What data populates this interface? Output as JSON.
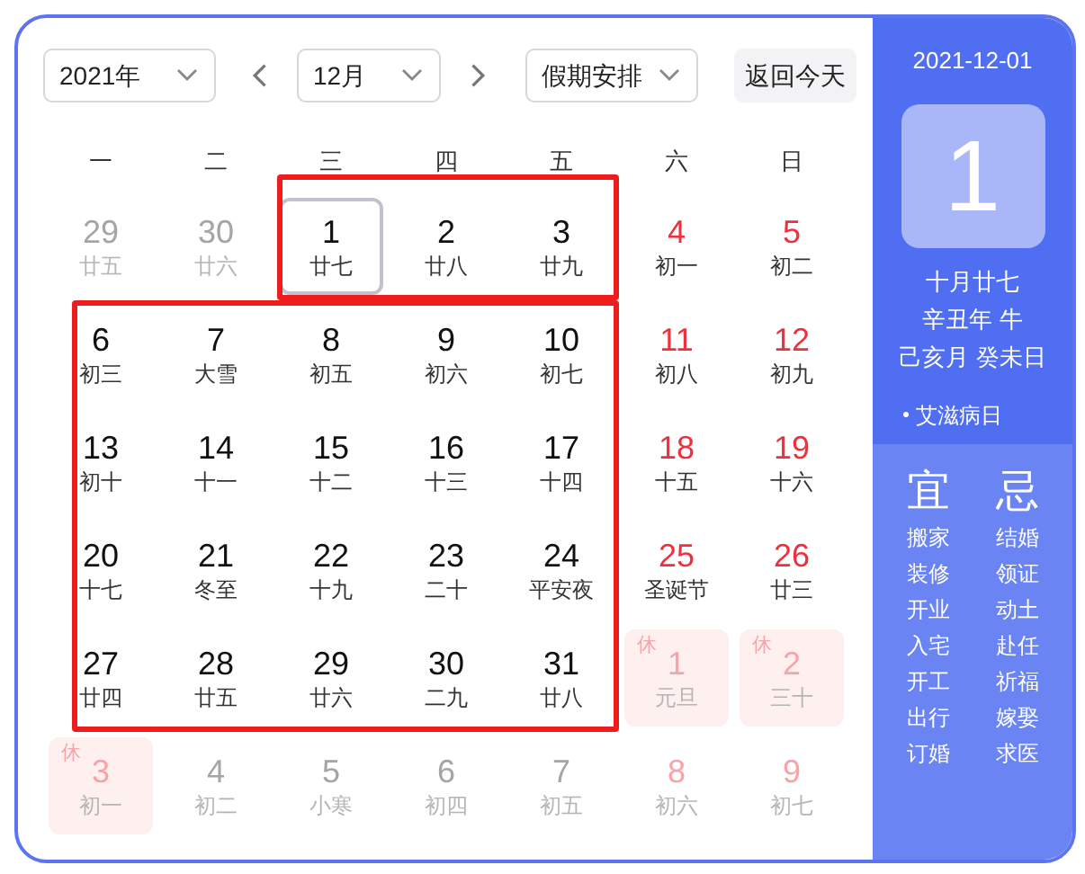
{
  "toolbar": {
    "year_select": "2021年",
    "month_select": "12月",
    "holiday_select": "假期安排",
    "today_button": "返回今天"
  },
  "weekdays": [
    "一",
    "二",
    "三",
    "四",
    "五",
    "六",
    "日"
  ],
  "weeks": [
    [
      {
        "date": "29",
        "lunar": "廿五",
        "muted": true,
        "weekend": false,
        "selected": false
      },
      {
        "date": "30",
        "lunar": "廿六",
        "muted": true,
        "weekend": false,
        "selected": false
      },
      {
        "date": "1",
        "lunar": "廿七",
        "muted": false,
        "weekend": false,
        "selected": true
      },
      {
        "date": "2",
        "lunar": "廿八",
        "muted": false,
        "weekend": false,
        "selected": false
      },
      {
        "date": "3",
        "lunar": "廿九",
        "muted": false,
        "weekend": false,
        "selected": false
      },
      {
        "date": "4",
        "lunar": "初一",
        "muted": false,
        "weekend": true,
        "selected": false
      },
      {
        "date": "5",
        "lunar": "初二",
        "muted": false,
        "weekend": true,
        "selected": false
      }
    ],
    [
      {
        "date": "6",
        "lunar": "初三",
        "muted": false,
        "weekend": false,
        "selected": false
      },
      {
        "date": "7",
        "lunar": "大雪",
        "muted": false,
        "weekend": false,
        "selected": false
      },
      {
        "date": "8",
        "lunar": "初五",
        "muted": false,
        "weekend": false,
        "selected": false
      },
      {
        "date": "9",
        "lunar": "初六",
        "muted": false,
        "weekend": false,
        "selected": false
      },
      {
        "date": "10",
        "lunar": "初七",
        "muted": false,
        "weekend": false,
        "selected": false
      },
      {
        "date": "11",
        "lunar": "初八",
        "muted": false,
        "weekend": true,
        "selected": false
      },
      {
        "date": "12",
        "lunar": "初九",
        "muted": false,
        "weekend": true,
        "selected": false
      }
    ],
    [
      {
        "date": "13",
        "lunar": "初十",
        "muted": false,
        "weekend": false,
        "selected": false
      },
      {
        "date": "14",
        "lunar": "十一",
        "muted": false,
        "weekend": false,
        "selected": false
      },
      {
        "date": "15",
        "lunar": "十二",
        "muted": false,
        "weekend": false,
        "selected": false
      },
      {
        "date": "16",
        "lunar": "十三",
        "muted": false,
        "weekend": false,
        "selected": false
      },
      {
        "date": "17",
        "lunar": "十四",
        "muted": false,
        "weekend": false,
        "selected": false
      },
      {
        "date": "18",
        "lunar": "十五",
        "muted": false,
        "weekend": true,
        "selected": false
      },
      {
        "date": "19",
        "lunar": "十六",
        "muted": false,
        "weekend": true,
        "selected": false
      }
    ],
    [
      {
        "date": "20",
        "lunar": "十七",
        "muted": false,
        "weekend": false,
        "selected": false
      },
      {
        "date": "21",
        "lunar": "冬至",
        "muted": false,
        "weekend": false,
        "selected": false
      },
      {
        "date": "22",
        "lunar": "十九",
        "muted": false,
        "weekend": false,
        "selected": false
      },
      {
        "date": "23",
        "lunar": "二十",
        "muted": false,
        "weekend": false,
        "selected": false
      },
      {
        "date": "24",
        "lunar": "平安夜",
        "muted": false,
        "weekend": false,
        "selected": false
      },
      {
        "date": "25",
        "lunar": "圣诞节",
        "muted": false,
        "weekend": true,
        "selected": false
      },
      {
        "date": "26",
        "lunar": "廿三",
        "muted": false,
        "weekend": true,
        "selected": false
      }
    ],
    [
      {
        "date": "27",
        "lunar": "廿四",
        "muted": false,
        "weekend": false,
        "selected": false
      },
      {
        "date": "28",
        "lunar": "廿五",
        "muted": false,
        "weekend": false,
        "selected": false
      },
      {
        "date": "29",
        "lunar": "廿六",
        "muted": false,
        "weekend": false,
        "selected": false
      },
      {
        "date": "30",
        "lunar": "二九",
        "muted": false,
        "weekend": false,
        "selected": false
      },
      {
        "date": "31",
        "lunar": "廿八",
        "muted": false,
        "weekend": false,
        "selected": false
      },
      {
        "date": "1",
        "lunar": "元旦",
        "rest": "休",
        "selected": false
      },
      {
        "date": "2",
        "lunar": "三十",
        "rest": "休",
        "selected": false
      }
    ],
    [
      {
        "date": "3",
        "lunar": "初一",
        "rest": "休",
        "selected": false
      },
      {
        "date": "4",
        "lunar": "初二",
        "muted": true,
        "weekend": false,
        "selected": false
      },
      {
        "date": "5",
        "lunar": "小寒",
        "muted": true,
        "weekend": false,
        "selected": false
      },
      {
        "date": "6",
        "lunar": "初四",
        "muted": true,
        "weekend": false,
        "selected": false
      },
      {
        "date": "7",
        "lunar": "初五",
        "muted": true,
        "weekend": false,
        "selected": false
      },
      {
        "date": "8",
        "lunar": "初六",
        "muted": true,
        "weekend": true,
        "selected": false
      },
      {
        "date": "9",
        "lunar": "初七",
        "muted": true,
        "weekend": true,
        "selected": false
      }
    ]
  ],
  "detail": {
    "date": "2021-12-01",
    "day": "1",
    "lunar_lines": [
      "十月廿七",
      "辛丑年 牛",
      "己亥月 癸未日"
    ],
    "festivals": [
      "艾滋病日"
    ],
    "good": {
      "title": "宜",
      "items": [
        "搬家",
        "装修",
        "开业",
        "入宅",
        "开工",
        "出行",
        "订婚"
      ]
    },
    "bad": {
      "title": "忌",
      "items": [
        "结婚",
        "领证",
        "动土",
        "赴任",
        "祈福",
        "嫁娶",
        "求医"
      ]
    }
  }
}
